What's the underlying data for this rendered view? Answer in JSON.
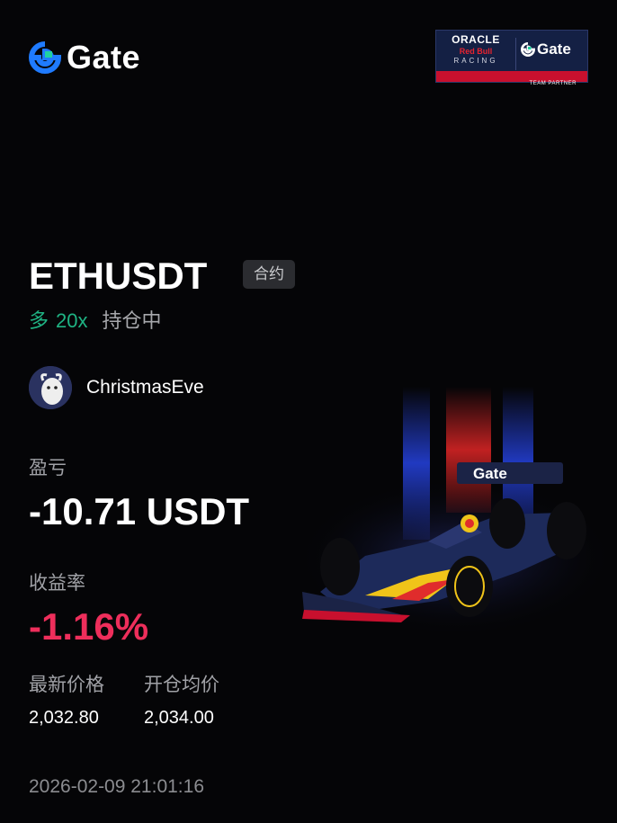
{
  "brand": {
    "name": "Gate",
    "icon": "gate-logo-icon",
    "color": "#1f7bff"
  },
  "partner": {
    "oracle": "ORACLE",
    "redbull": "Red Bull",
    "racing": "RACING",
    "gate": "Gate",
    "tagline": "TEAM PARTNER"
  },
  "trade": {
    "pair": "ETHUSDT",
    "type_tag": "合约",
    "side": "多",
    "leverage": "20x",
    "status": "持仓中"
  },
  "user": {
    "name": "ChristmasEve",
    "avatar_icon": "goat-avatar"
  },
  "pnl": {
    "label": "盈亏",
    "value": "-10.71 USDT"
  },
  "roi": {
    "label": "收益率",
    "value": "-1.16%",
    "color": "#ee2e5b"
  },
  "prices": {
    "latest_label": "最新价格",
    "latest_value": "2,032.80",
    "entry_label": "开仓均价",
    "entry_value": "2,034.00"
  },
  "timestamp": "2026-02-09 21:01:16",
  "colors": {
    "long": "#1fb383",
    "negative": "#ee2e5b",
    "background": "#050507"
  }
}
